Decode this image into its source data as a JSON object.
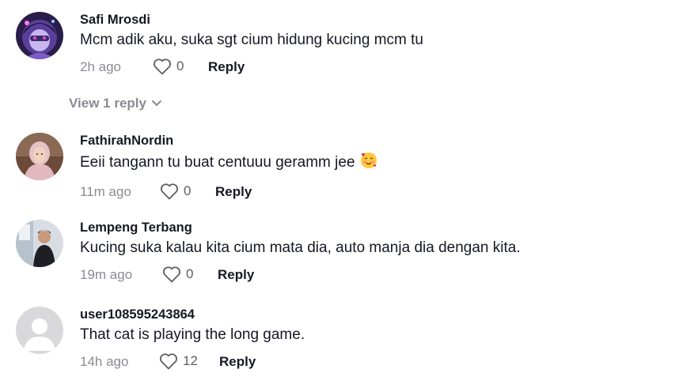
{
  "comments": [
    {
      "username": "Safi Mrosdi",
      "text": "Mcm adik aku, suka sgt cium hidung kucing mcm tu",
      "time": "2h ago",
      "likes": "0",
      "reply_label": "Reply",
      "avatar_icon": "anime-avatar-icon"
    },
    {
      "username": "FathirahNordin",
      "text": "Eeii tangann tu buat centuuu geramm jee",
      "emoji": "smiling-face-with-hearts-emoji",
      "time": "11m ago",
      "likes": "0",
      "reply_label": "Reply",
      "avatar_icon": "hijab-person-avatar-icon"
    },
    {
      "username": "Lempeng Terbang",
      "text": "Kucing suka kalau kita cium mata dia, auto manja dia dengan kita.",
      "time": "19m ago",
      "likes": "0",
      "reply_label": "Reply",
      "avatar_icon": "person-photo-avatar-icon"
    },
    {
      "username": "user108595243864",
      "text": "That cat is playing the long game.",
      "time": "14h ago",
      "likes": "12",
      "reply_label": "Reply",
      "avatar_icon": "default-user-avatar-icon"
    }
  ],
  "view_replies": {
    "label": "View 1 reply",
    "icon": "chevron-down-icon"
  },
  "colors": {
    "text_primary": "#161823",
    "text_secondary": "#8a8b91",
    "default_avatar_bg": "#d9d9db"
  }
}
